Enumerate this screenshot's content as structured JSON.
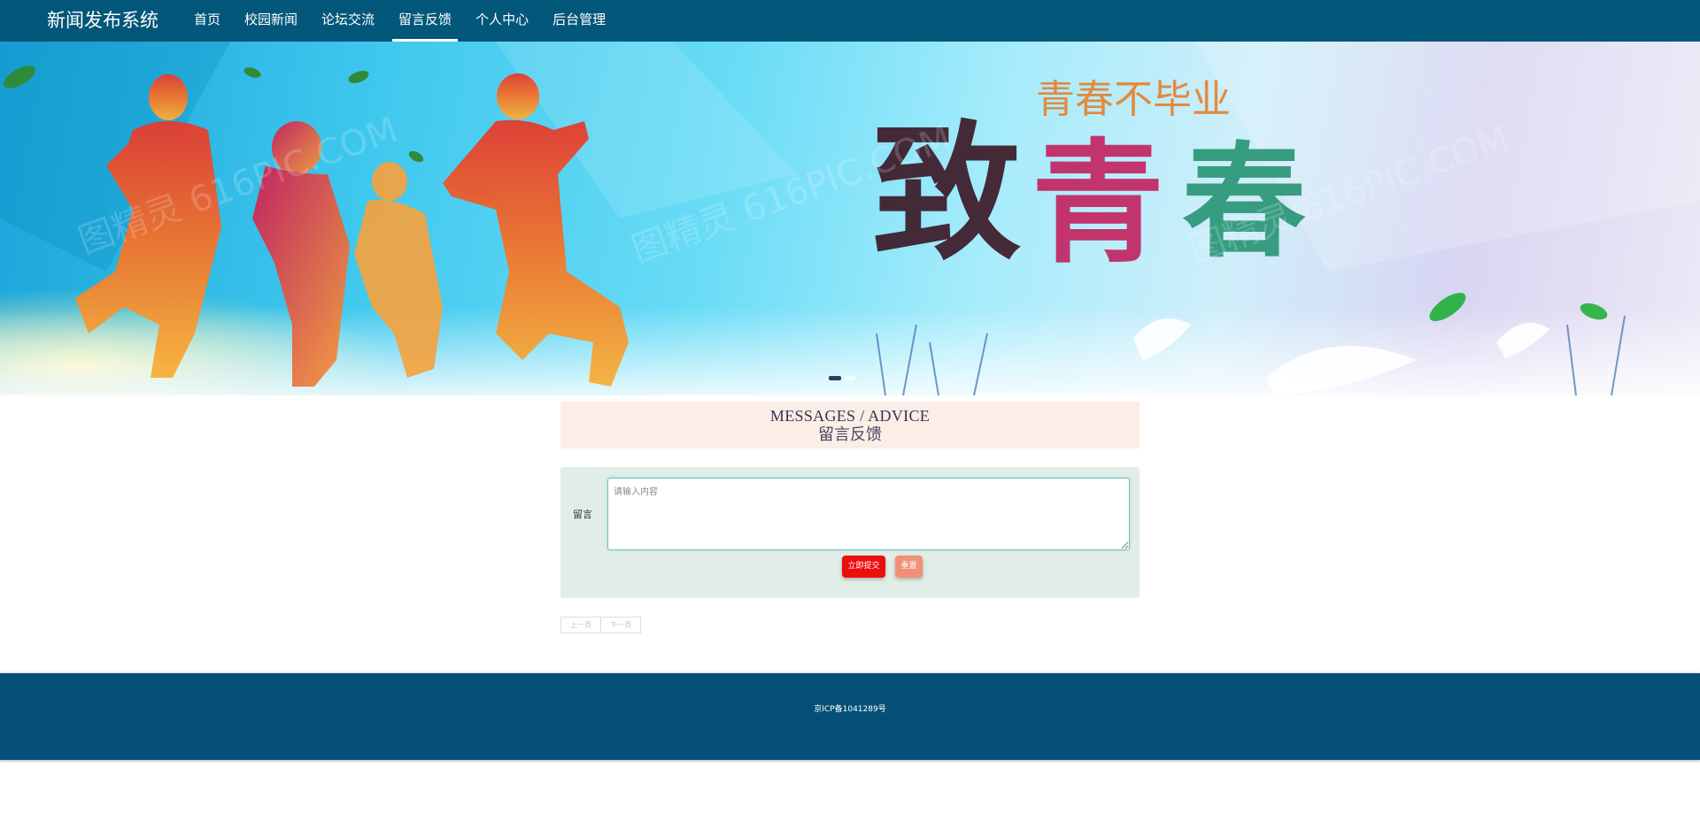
{
  "header": {
    "brand": "新闻发布系统",
    "nav": [
      {
        "label": "首页",
        "active": false
      },
      {
        "label": "校园新闻",
        "active": false
      },
      {
        "label": "论坛交流",
        "active": false
      },
      {
        "label": "留言反馈",
        "active": true
      },
      {
        "label": "个人中心",
        "active": false
      },
      {
        "label": "后台管理",
        "active": false
      }
    ]
  },
  "banner": {
    "title": "致青春",
    "subtitle": "青春不毕业",
    "watermark": "图精灵 616PIC.COM",
    "slide_count": 2,
    "active_slide": 1
  },
  "section": {
    "title_en": "MESSAGES / ADVICE",
    "title_cn": "留言反馈"
  },
  "form": {
    "label": "留言",
    "placeholder": "请输入内容",
    "value": "",
    "submit_label": "立即提交",
    "reset_label": "重置"
  },
  "pager": {
    "prev_label": "上一页",
    "next_label": "下一页"
  },
  "footer": {
    "icp": "京ICP备1041289号"
  },
  "colors": {
    "nav_bg": "#02577a",
    "footer_bg": "#055078",
    "section_bg": "#fbeee7",
    "form_bg": "#e1ede6",
    "submit_btn": "#ec0d0d",
    "reset_btn": "#f19078"
  }
}
